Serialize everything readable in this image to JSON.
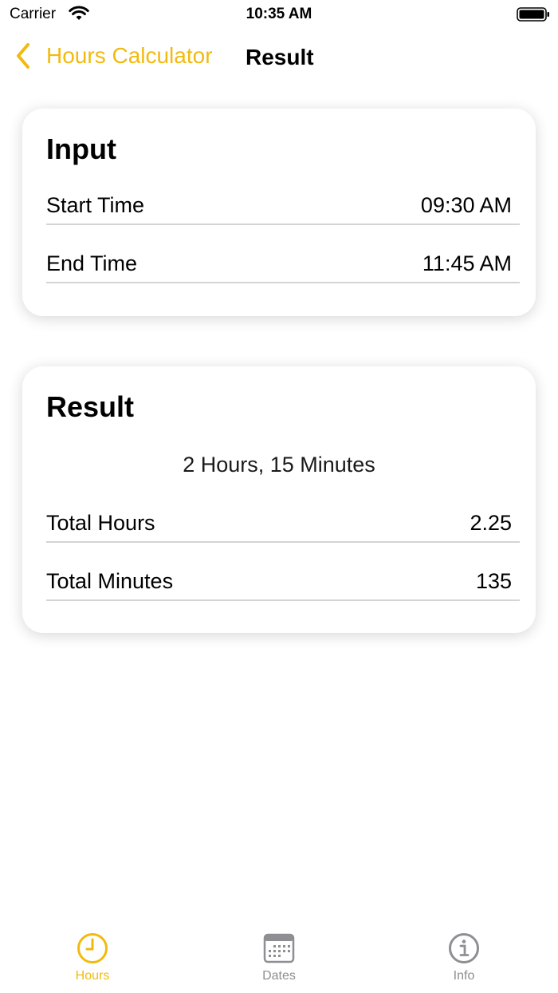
{
  "status_bar": {
    "carrier": "Carrier",
    "time": "10:35 AM"
  },
  "nav": {
    "back_label": "Hours Calculator",
    "title": "Result"
  },
  "input_card": {
    "title": "Input",
    "rows": [
      {
        "label": "Start Time",
        "value": "09:30 AM"
      },
      {
        "label": "End Time",
        "value": "11:45 AM"
      }
    ]
  },
  "result_card": {
    "title": "Result",
    "summary": "2 Hours, 15 Minutes",
    "rows": [
      {
        "label": "Total Hours",
        "value": "2.25"
      },
      {
        "label": "Total Minutes",
        "value": "135"
      }
    ]
  },
  "tabs": [
    {
      "label": "Hours",
      "icon": "clock-icon",
      "active": true
    },
    {
      "label": "Dates",
      "icon": "calendar-icon",
      "active": false
    },
    {
      "label": "Info",
      "icon": "info-icon",
      "active": false
    }
  ],
  "colors": {
    "accent": "#F2BA0E",
    "inactive": "#8e8e93",
    "divider": "#d4d4d4"
  }
}
